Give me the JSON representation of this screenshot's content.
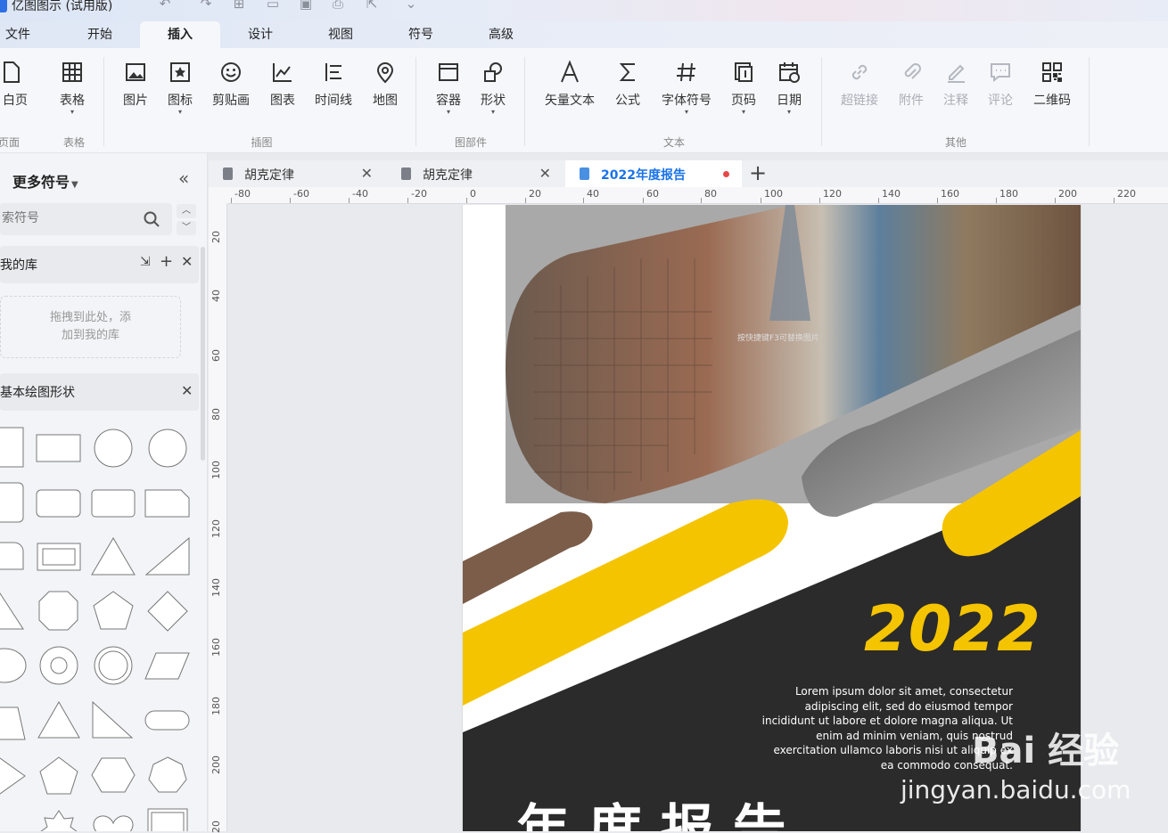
{
  "app": {
    "title": "亿图图示 (试用版)"
  },
  "menu": {
    "tabs": [
      "文件",
      "开始",
      "插入",
      "设计",
      "视图",
      "符号",
      "高级"
    ],
    "active": "插入"
  },
  "ribbon": {
    "groups": [
      "页面",
      "表格",
      "插图",
      "图部件",
      "文本",
      "其他"
    ],
    "buttons": {
      "page": "白页",
      "table": "表格",
      "image": "图片",
      "icon": "图标",
      "clipart": "剪贴画",
      "chart": "图表",
      "timeline": "时间线",
      "map": "地图",
      "container": "容器",
      "shape": "形状",
      "vector_text": "矢量文本",
      "formula": "公式",
      "font_symbol": "字体符号",
      "page_number": "页码",
      "date": "日期",
      "hyperlink": "超链接",
      "attachment": "附件",
      "note": "注释",
      "comment": "评论",
      "qrcode": "二维码"
    }
  },
  "left_panel": {
    "title": "更多符号",
    "search_placeholder": "搜索符号",
    "my_library": "我的库",
    "drop_hint_1": "拖拽到此处，添",
    "drop_hint_2": "加到我的库",
    "basic_shapes": "基本绘图形状"
  },
  "doc_tabs": [
    {
      "label": "胡克定律",
      "active": false
    },
    {
      "label": "胡克定律",
      "active": false
    },
    {
      "label": "2022年度报告",
      "active": true,
      "unsaved": true
    }
  ],
  "ruler": {
    "h_ticks": [
      "-80",
      "-60",
      "-40",
      "-20",
      "0",
      "20",
      "40",
      "60",
      "80",
      "100",
      "120",
      "140",
      "160",
      "180",
      "200",
      "220"
    ],
    "v_ticks": [
      "20",
      "40",
      "60",
      "80",
      "100",
      "120",
      "140",
      "160",
      "180",
      "200",
      "20"
    ]
  },
  "document": {
    "year": "2022",
    "body": "Lorem ipsum dolor sit amet, consectetur adipiscing elit, sed do eiusmod tempor incididunt ut labore et dolore magna aliqua. Ut enim ad minim veniam, quis nostrud exercitation ullamco laboris nisi ut aliquip ex ea commodo consequat.",
    "image_placeholder": "按快捷键F3可替换图片",
    "colors": {
      "yellow": "#f5c400",
      "dark": "#2b2b2b",
      "gray": "#9e9e9e"
    }
  },
  "watermark": {
    "brand": "Bai 经验",
    "url": "jingyan.baidu.com"
  }
}
